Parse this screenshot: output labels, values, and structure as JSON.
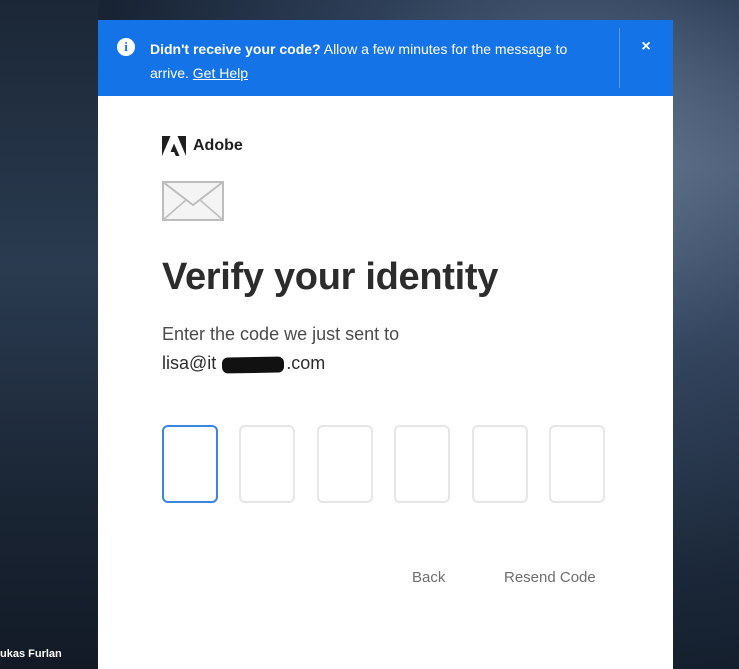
{
  "banner": {
    "bold_text": "Didn't receive your code?",
    "text": " Allow a few minutes for the message to arrive. ",
    "link": "Get Help",
    "close_symbol": "×",
    "info_symbol": "i"
  },
  "brand": {
    "name": "Adobe",
    "color": "#1e1e1e"
  },
  "icons": [
    "info-icon",
    "close-icon",
    "adobe-logo-icon",
    "envelope-icon"
  ],
  "page": {
    "title": "Verify your identity",
    "subtitle": "Enter the code we just sent to",
    "email_prefix": "lisa@it",
    "email_suffix": ".com"
  },
  "code": {
    "length": 6,
    "values": [
      "",
      "",
      "",
      "",
      "",
      ""
    ],
    "active_index": 0
  },
  "actions": {
    "back": "Back",
    "resend": "Resend Code"
  },
  "background": {
    "photo_credit": "ukas Furlan"
  },
  "colors": {
    "banner": "#1473e6",
    "active_border": "#3a86e0",
    "inactive_border": "#e6e6e6"
  }
}
